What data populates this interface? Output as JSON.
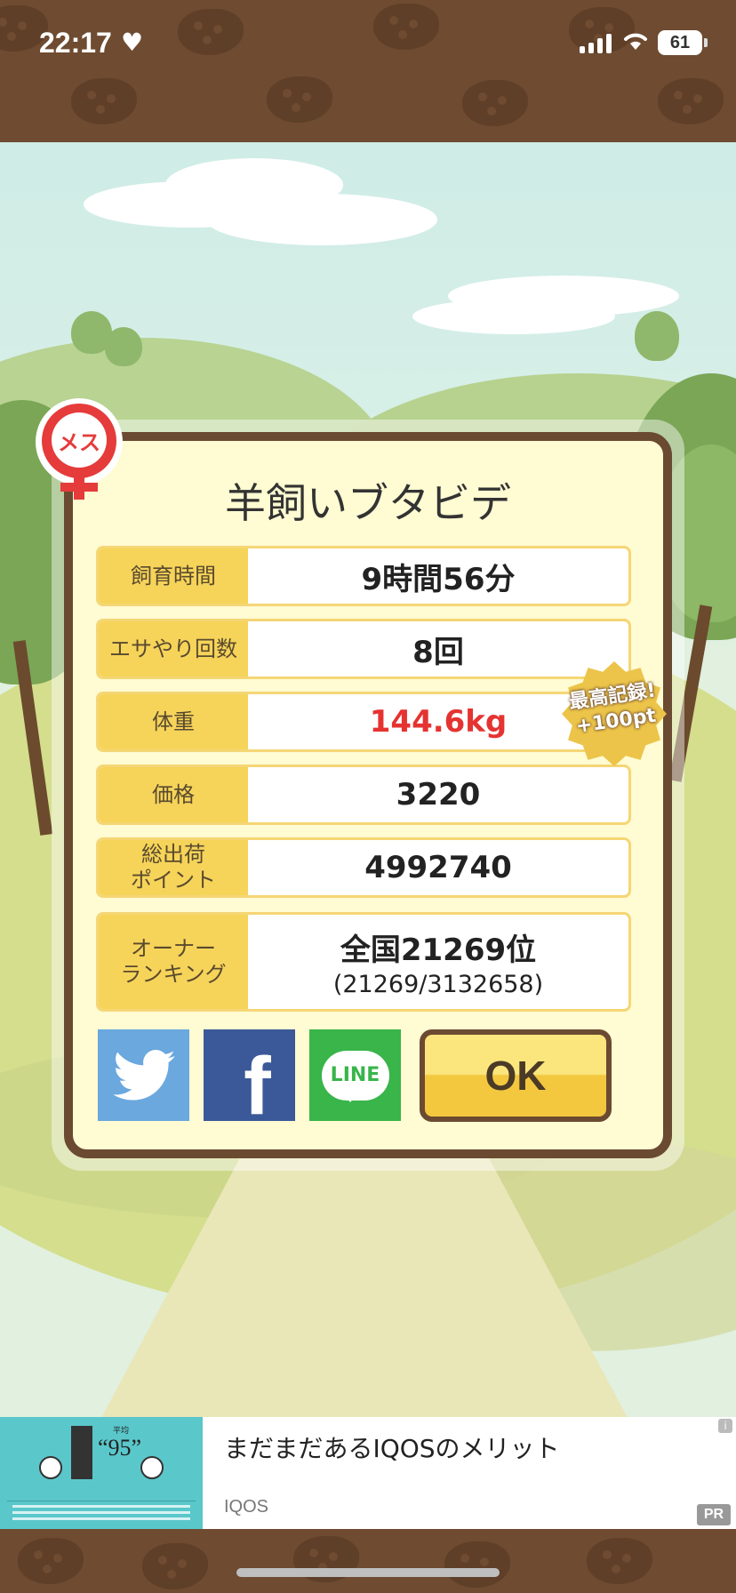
{
  "status_bar": {
    "time": "22:17",
    "battery": "61"
  },
  "card": {
    "title": "羊飼いブタビデ",
    "gender": "メス",
    "rows": [
      {
        "label": "飼育時間",
        "value": "9時間56分"
      },
      {
        "label": "エサやり回数",
        "value": "8回"
      },
      {
        "label": "体重",
        "value": "144.6kg"
      },
      {
        "label": "価格",
        "value": "3220"
      },
      {
        "label": "総出荷\nポイント",
        "value": "4992740"
      },
      {
        "label": "オーナー\nランキング",
        "value": "全国21269位",
        "sub": "(21269/3132658)"
      }
    ],
    "record_badge": {
      "line1": "最高記録!",
      "line2": "+100pt"
    }
  },
  "share": {
    "line_label": "LINE",
    "ok_label": "OK"
  },
  "ad": {
    "title": "まだまだあるIQOSのメリット",
    "brand": "IQOS",
    "pr": "PR",
    "info": "i",
    "image_number": "“95”",
    "image_small": "平均"
  },
  "colors": {
    "accent_red": "#e53331",
    "label_yellow": "#f6d45a",
    "frame_brown": "#6b4a32"
  }
}
